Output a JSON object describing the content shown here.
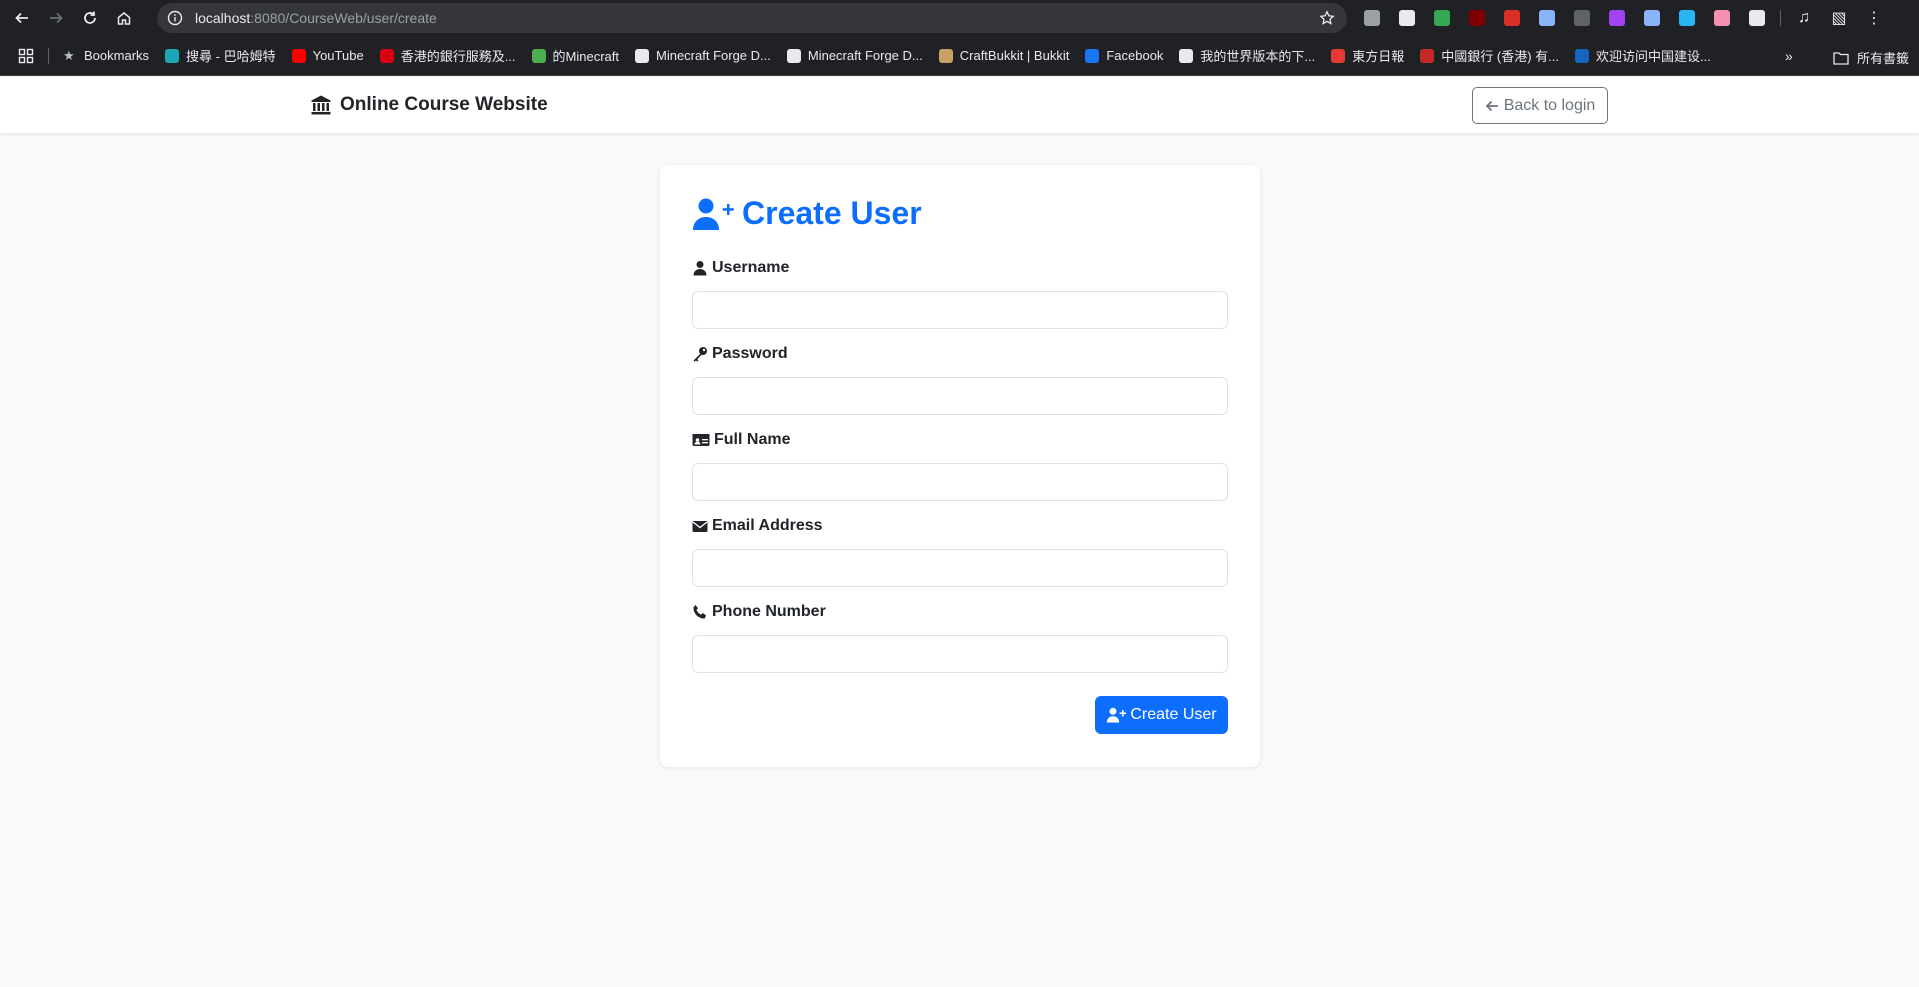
{
  "browser": {
    "url_host": "localhost",
    "url_rest": ":8080/CourseWeb/user/create",
    "bookmarks": [
      {
        "label": "Bookmarks",
        "color": "#bdc1c6"
      },
      {
        "label": "搜尋 - 巴哈姆特",
        "color": "#1aa8b8"
      },
      {
        "label": "YouTube",
        "color": "#ff0000"
      },
      {
        "label": "香港的銀行服務及...",
        "color": "#db0011"
      },
      {
        "label": "的Minecraft",
        "color": "#4caf50"
      },
      {
        "label": "Minecraft Forge D...",
        "color": "#e8eaed"
      },
      {
        "label": "Minecraft Forge D...",
        "color": "#e8eaed"
      },
      {
        "label": "CraftBukkit | Bukkit",
        "color": "#c8a165"
      },
      {
        "label": "Facebook",
        "color": "#1877f2"
      },
      {
        "label": "我的世界版本的下...",
        "color": "#e8eaed"
      },
      {
        "label": "東方日報",
        "color": "#e53935"
      },
      {
        "label": "中國銀行 (香港) 有...",
        "color": "#c62828"
      },
      {
        "label": "欢迎访问中国建设...",
        "color": "#1565c0"
      }
    ],
    "more_label": "»",
    "folder_label": "所有書籤",
    "extensions": [
      {
        "name": "translate-icon",
        "color": "#9aa0a6"
      },
      {
        "name": "eyes-icon",
        "color": "#e8eaed"
      },
      {
        "name": "leaf-icon",
        "color": "#34a853"
      },
      {
        "name": "ublock-icon",
        "color": "#800000"
      },
      {
        "name": "hd-icon",
        "color": "#d93025"
      },
      {
        "name": "image-icon",
        "color": "#8ab4f8"
      },
      {
        "name": "robot-icon",
        "color": "#5f6368"
      },
      {
        "name": "circle-icon",
        "color": "#a142f4"
      },
      {
        "name": "face-icon",
        "color": "#8ab4f8"
      },
      {
        "name": "telegram-icon",
        "color": "#29b6f6"
      },
      {
        "name": "cat-icon",
        "color": "#f48fb1"
      },
      {
        "name": "puzzle-icon",
        "color": "#e8eaed"
      }
    ]
  },
  "navbar": {
    "brand": "Online Course Website",
    "back_label": "Back to login"
  },
  "form": {
    "title": "Create User",
    "fields": [
      {
        "label": "Username",
        "value": "",
        "icon": "user-icon"
      },
      {
        "label": "Password",
        "value": "",
        "icon": "key-icon"
      },
      {
        "label": "Full Name",
        "value": "",
        "icon": "id-card-icon"
      },
      {
        "label": "Email Address",
        "value": "",
        "icon": "envelope-icon"
      },
      {
        "label": "Phone Number",
        "value": "",
        "icon": "phone-icon"
      }
    ],
    "submit_label": "Create User"
  },
  "colors": {
    "primary": "#0d6efd",
    "secondary": "#6c757d",
    "page_bg": "#f8f9fa",
    "browser_chrome": "#202124"
  }
}
